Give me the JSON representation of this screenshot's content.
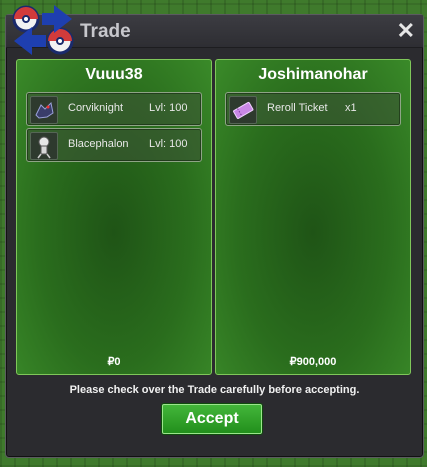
{
  "window": {
    "title": "Trade"
  },
  "left_panel": {
    "player_name": "Vuuu38",
    "items": [
      {
        "name": "Corviknight",
        "level": "Lvl: 100",
        "icon": "corviknight-sprite-icon"
      },
      {
        "name": "Blacephalon",
        "level": "Lvl: 100",
        "icon": "blacephalon-sprite-icon"
      }
    ],
    "money": "₽0"
  },
  "right_panel": {
    "player_name": "Joshimanohar",
    "items": [
      {
        "name": "Reroll Ticket",
        "quantity": "x1",
        "icon": "ticket-icon"
      }
    ],
    "money": "₽900,000"
  },
  "notice": "Please check over the Trade carefully before accepting.",
  "accept_label": "Accept",
  "colors": {
    "panel_border": "#7fc75a",
    "accept_button": "#2fa52a",
    "window_bg": "#2b2b2f"
  }
}
